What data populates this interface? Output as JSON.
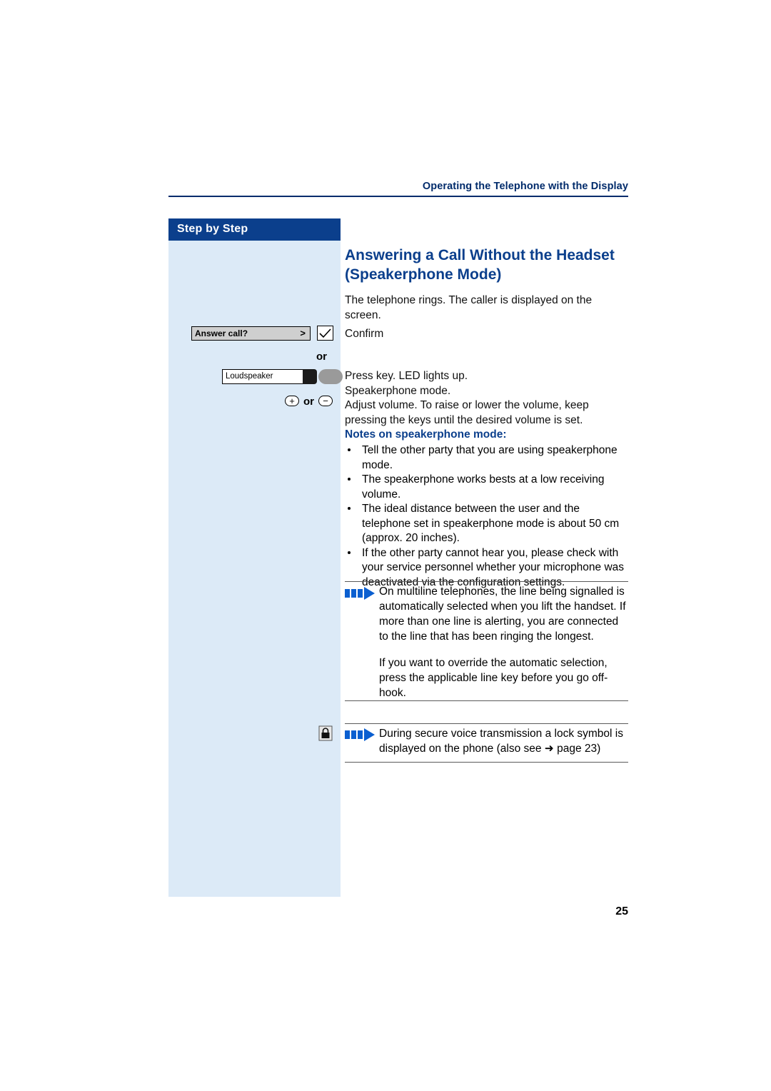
{
  "header": {
    "running_head": "Operating the Telephone with the Display"
  },
  "sidebar": {
    "title": "Step by Step"
  },
  "main": {
    "title_line1": "Answering a Call Without the Headset",
    "title_line2": "(Speakerphone Mode)",
    "intro": "The telephone rings. The caller is displayed on the screen.",
    "confirm": "Confirm",
    "press_key": "Press key. LED lights up.",
    "speakerphone_mode": "Speakerphone mode.",
    "adjust_volume": "Adjust volume. To raise or lower the volume, keep pressing the keys until the desired volume is set.",
    "or_label_1": "or",
    "or_label_2": "or",
    "notes_title": "Notes on speakerphone mode:",
    "bullets": [
      "Tell the other party that you are using speakerphone mode.",
      "The speakerphone works bests at a low receiving volume.",
      "The ideal distance between the user and the telephone set in speakerphone mode is about 50 cm (approx. 20 inches).",
      "If the other party cannot hear you, please check with your service personnel whether your microphone was deactivated via the configuration settings."
    ],
    "note1": "On multiline telephones, the line being signalled is automatically selected when you lift the handset. If more than one line is alerting, you are connected to the line that has been ringing the longest.",
    "note2": "If you want to override the automatic selection, press the applicable line key before you go off-hook.",
    "note3": "During secure voice transmission a lock symbol is displayed on the phone (also see ➜ page 23)"
  },
  "keys": {
    "answer_call_label": "Answer call?",
    "answer_call_arrow": ">",
    "loudspeaker_label": "Loudspeaker",
    "plus_glyph": "+",
    "minus_glyph": "−"
  },
  "footer": {
    "page_number": "25"
  }
}
